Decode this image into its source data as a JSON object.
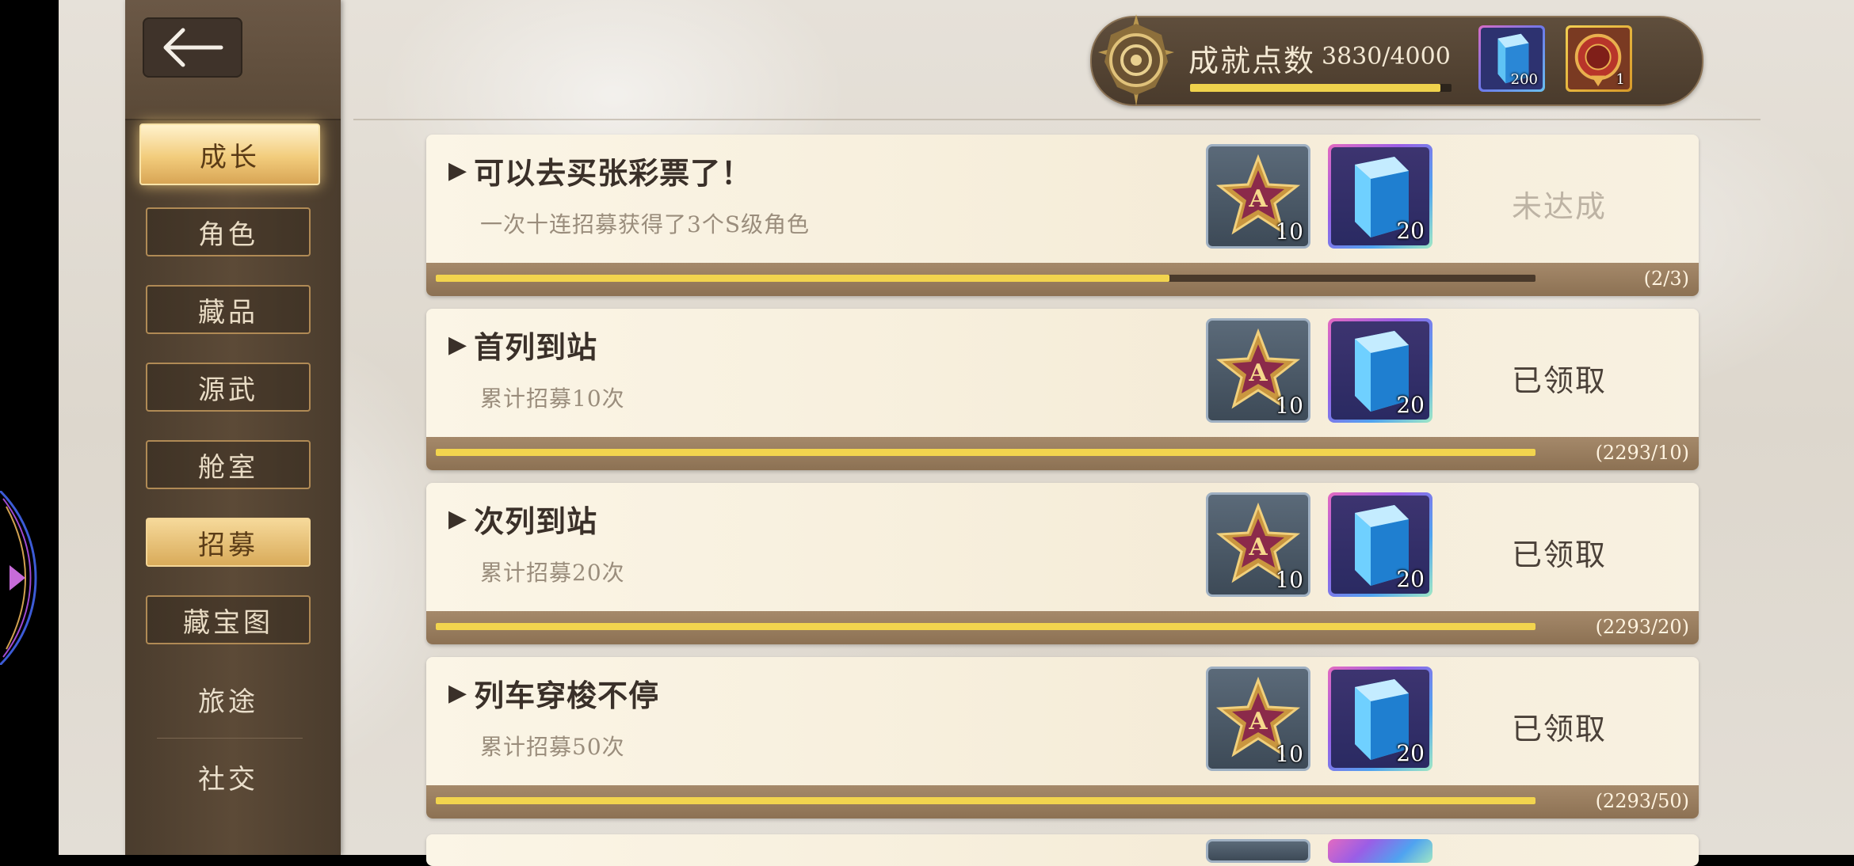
{
  "header": {
    "achievement_label": "成就点数",
    "achievement_value": "3830/4000",
    "achievement_progress": 0.9575,
    "rewards": [
      {
        "icon": "blue-crystal-icon",
        "count": "200"
      },
      {
        "icon": "red-emblem-icon",
        "count": "1"
      }
    ]
  },
  "sidebar": {
    "items": [
      {
        "label": "成长",
        "state": "active"
      },
      {
        "label": "角色",
        "state": "normal"
      },
      {
        "label": "藏品",
        "state": "normal"
      },
      {
        "label": "源武",
        "state": "normal"
      },
      {
        "label": "舱室",
        "state": "normal"
      },
      {
        "label": "招募",
        "state": "highlight"
      },
      {
        "label": "藏宝图",
        "state": "normal"
      },
      {
        "label": "旅途",
        "state": "plain"
      },
      {
        "label": "社交",
        "state": "plain"
      }
    ]
  },
  "achievements": [
    {
      "title": "可以去买张彩票了！",
      "desc": "一次十连招募获得了3个S级角色",
      "status": "未达成",
      "progress": 0.667,
      "count": "(2/3)",
      "reward_a_count": "10",
      "reward_b_count": "20"
    },
    {
      "title": "首列到站",
      "desc": "累计招募10次",
      "status": "已领取",
      "progress": 1.0,
      "count": "(2293/10)",
      "reward_a_count": "10",
      "reward_b_count": "20"
    },
    {
      "title": "次列到站",
      "desc": "累计招募20次",
      "status": "已领取",
      "progress": 1.0,
      "count": "(2293/20)",
      "reward_a_count": "10",
      "reward_b_count": "20"
    },
    {
      "title": "列车穿梭不停",
      "desc": "累计招募50次",
      "status": "已领取",
      "progress": 1.0,
      "count": "(2293/50)",
      "reward_a_count": "10",
      "reward_b_count": "20"
    }
  ],
  "colors": {
    "progress_fill": "#f2d44e",
    "sidebar_bg": "#4a3c2d",
    "card_bg": "#fbf5e6"
  }
}
